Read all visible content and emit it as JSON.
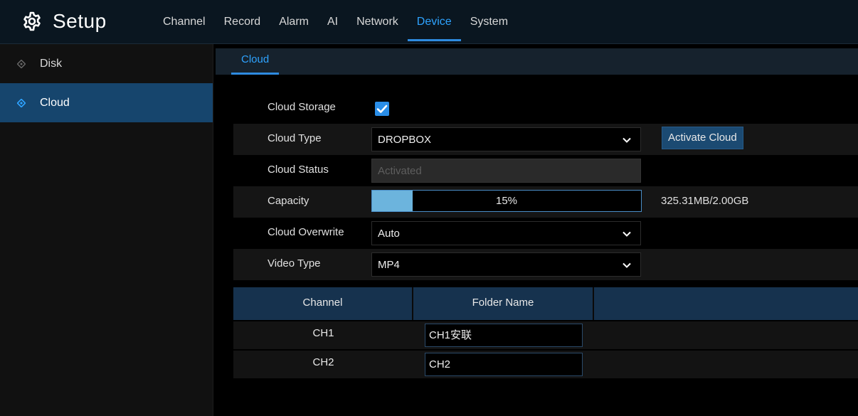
{
  "header": {
    "title": "Setup",
    "nav": [
      "Channel",
      "Record",
      "Alarm",
      "AI",
      "Network",
      "Device",
      "System"
    ],
    "active_nav": "Device"
  },
  "sidebar": {
    "items": [
      {
        "label": "Disk",
        "active": false
      },
      {
        "label": "Cloud",
        "active": true
      }
    ]
  },
  "main": {
    "tab": "Cloud",
    "cloud_storage": {
      "label": "Cloud Storage",
      "checked": true
    },
    "cloud_type": {
      "label": "Cloud Type",
      "value": "DROPBOX",
      "button": "Activate Cloud"
    },
    "cloud_status": {
      "label": "Cloud Status",
      "value": "Activated"
    },
    "capacity": {
      "label": "Capacity",
      "percent_text": "15%",
      "percent": 15,
      "usage": "325.31MB/2.00GB"
    },
    "cloud_overwrite": {
      "label": "Cloud Overwrite",
      "value": "Auto"
    },
    "video_type": {
      "label": "Video Type",
      "value": "MP4"
    },
    "table": {
      "headers": [
        "Channel",
        "Folder Name"
      ],
      "rows": [
        {
          "channel": "CH1",
          "folder": "CH1安联"
        },
        {
          "channel": "CH2",
          "folder": "CH2"
        }
      ]
    }
  },
  "colors": {
    "accent": "#2ea3ff",
    "active_bg": "#16456d",
    "progress_fill": "#6cb4dd"
  }
}
